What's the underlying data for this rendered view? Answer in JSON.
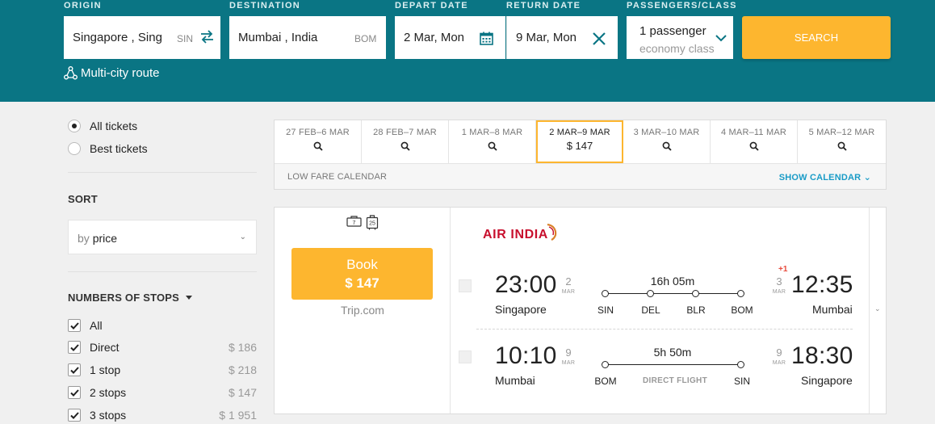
{
  "search": {
    "origin_label": "ORIGIN",
    "origin_value": "Singapore , Sing",
    "origin_code": "SIN",
    "destination_label": "DESTINATION",
    "destination_value": "Mumbai , India",
    "destination_code": "BOM",
    "depart_label": "DEPART DATE",
    "depart_value": "2 Mar, Mon",
    "return_label": "RETURN DATE",
    "return_value": "9 Mar, Mon",
    "pax_label": "PASSENGERS/CLASS",
    "pax_value": "1 passenger",
    "class_value": "economy class",
    "search_button": "SEARCH",
    "multi_city": "Multi-city route"
  },
  "filters": {
    "all_tickets": "All tickets",
    "best_tickets": "Best tickets",
    "sort_title": "SORT",
    "sort_prefix": "by",
    "sort_value": "price",
    "stops_title": "NUMBERS OF STOPS",
    "stops": [
      {
        "label": "All",
        "price": ""
      },
      {
        "label": "Direct",
        "price": "$ 186"
      },
      {
        "label": "1 stop",
        "price": "$ 218"
      },
      {
        "label": "2 stops",
        "price": "$ 147"
      },
      {
        "label": "3 stops",
        "price": "$ 1 951"
      }
    ]
  },
  "dates": {
    "cells": [
      {
        "label": "27 FEB–6 MAR",
        "price": ""
      },
      {
        "label": "28 FEB–7 MAR",
        "price": ""
      },
      {
        "label": "1 MAR–8 MAR",
        "price": ""
      },
      {
        "label": "2 MAR–9 MAR",
        "price": "$ 147"
      },
      {
        "label": "3 MAR–10 MAR",
        "price": ""
      },
      {
        "label": "4 MAR–11 MAR",
        "price": ""
      },
      {
        "label": "5 MAR–12 MAR",
        "price": ""
      }
    ],
    "low_fare_calendar": "LOW FARE CALENDAR",
    "show_calendar": "SHOW CALENDAR"
  },
  "result": {
    "book_label": "Book",
    "book_price": "$ 147",
    "agency": "Trip.com",
    "airline": "AIR INDIA",
    "outbound": {
      "dep_time": "23:00",
      "dep_day": "2",
      "dep_mon": "MAR",
      "dep_city": "Singapore",
      "duration": "16h 05m",
      "stops": [
        "SIN",
        "DEL",
        "BLR",
        "BOM"
      ],
      "arr_time": "12:35",
      "arr_day": "3",
      "arr_mon": "MAR",
      "arr_city": "Mumbai",
      "day_offset": "+1"
    },
    "inbound": {
      "dep_time": "10:10",
      "dep_day": "9",
      "dep_mon": "MAR",
      "dep_city": "Mumbai",
      "duration": "5h 50m",
      "stops": [
        "BOM",
        "SIN"
      ],
      "direct_label": "DIRECT FLIGHT",
      "arr_time": "18:30",
      "arr_day": "9",
      "arr_mon": "MAR",
      "arr_city": "Singapore"
    }
  },
  "colors": {
    "header_bg": "#0a7584",
    "accent_orange": "#fdb62f",
    "link_blue": "#1a9cc7",
    "airline_red": "#c8102e"
  }
}
